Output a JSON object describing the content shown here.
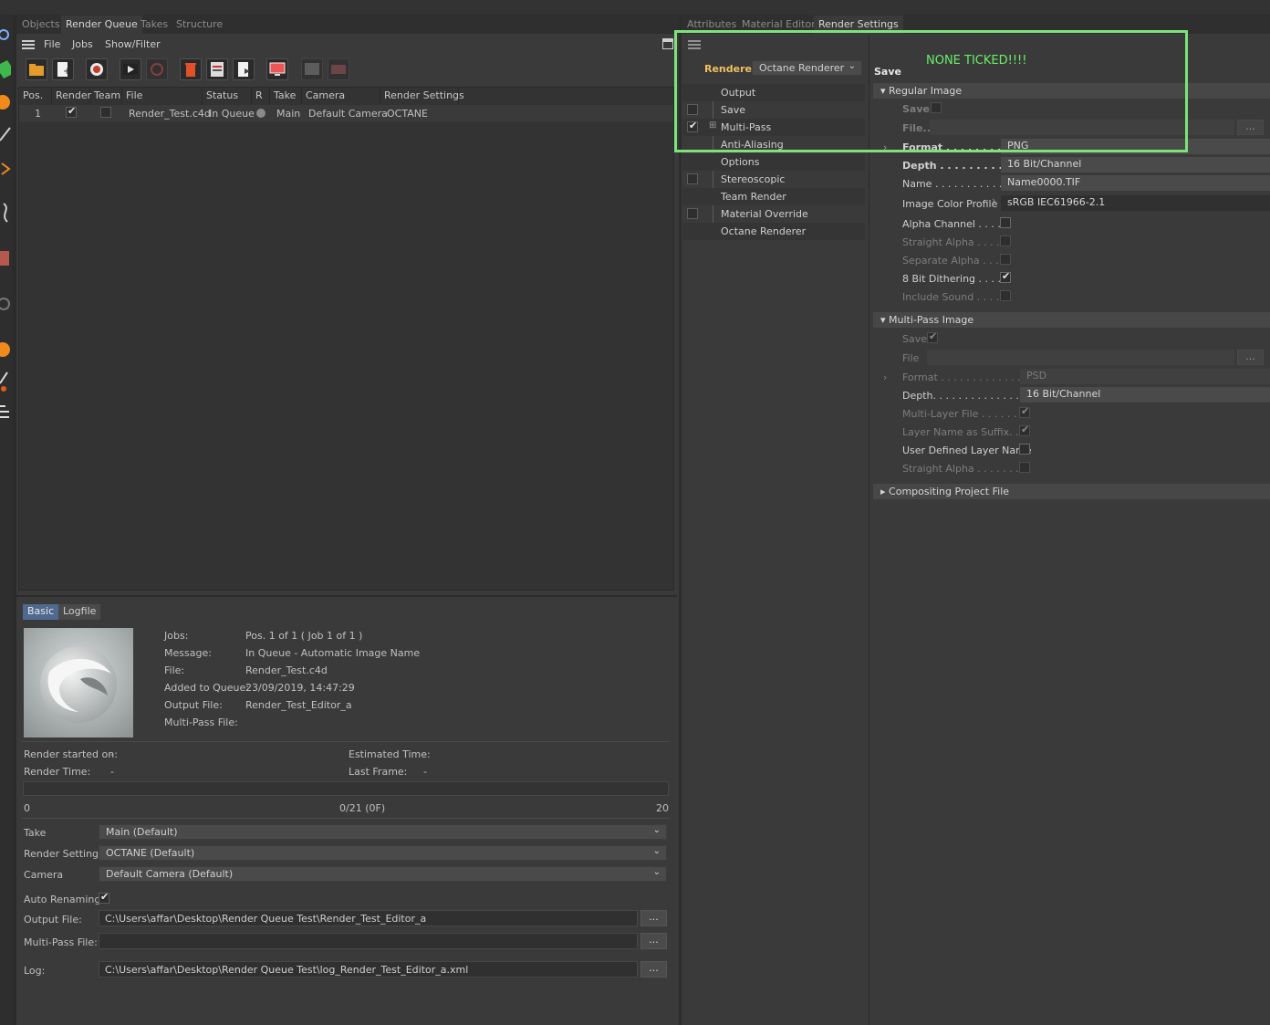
{
  "colors": {
    "accent_orange": "#f19c3c",
    "annotation_green": "#7ce27a",
    "panel_bg": "#3a3a3a"
  },
  "left_panel": {
    "tabs": [
      "Objects",
      "Render Queue",
      "Takes",
      "Structure"
    ],
    "menu": [
      "File",
      "Jobs",
      "Show/Filter"
    ],
    "toolbar_icons": [
      "open-folder-icon",
      "new-job-icon",
      "camera-icon",
      "render-icon",
      "stop-icon",
      "delete-icon",
      "info-icon",
      "export-icon",
      "monitor-icon",
      "picture-viewer-icon",
      "settings-icon"
    ],
    "table": {
      "headers": [
        "Pos.",
        "Render",
        "Team",
        "File",
        "Status",
        "R",
        "Take",
        "Camera",
        "Render Settings"
      ],
      "rows": [
        {
          "pos": "1",
          "render": true,
          "team": false,
          "file": "Render_Test.c4d",
          "status": "In Queue",
          "take": "Main",
          "camera": "Default Camera",
          "render_settings": "OCTANE"
        }
      ]
    },
    "bottom": {
      "tabs": [
        "Basic",
        "Logfile"
      ],
      "info_labels": [
        "Jobs:",
        "Message:",
        "File:",
        "Added to Queue:",
        "Output File:",
        "Multi-Pass File:"
      ],
      "info_values": [
        "Pos. 1 of 1 ( Job 1 of 1 )",
        "In Queue - Automatic Image Name",
        "Render_Test.c4d",
        "23/09/2019, 14:47:29",
        "Render_Test_Editor_a",
        ""
      ],
      "render_started_label": "Render started on:",
      "render_started_value": "-",
      "render_time_label": "Render Time:",
      "render_time_value": "-",
      "estimated_label": "Estimated Time:",
      "estimated_value": "-",
      "last_frame_label": "Last Frame:",
      "last_frame_value": "-",
      "progress_start": "0",
      "progress_text": "0/21 (0F)",
      "progress_end": "20",
      "progress_fraction": 0,
      "take_label": "Take",
      "take_value": "Main (Default)",
      "settings_label": "Render Settings",
      "settings_value": "OCTANE (Default)",
      "camera_label": "Camera",
      "camera_value": "Default Camera (Default)",
      "auto_renaming_label": "Auto Renaming",
      "auto_renaming": true,
      "output_label": "Output File:",
      "output_value": "C:\\Users\\affar\\Desktop\\Render Queue Test\\Render_Test_Editor_a",
      "multipass_label": "Multi-Pass File:",
      "multipass_value": "",
      "log_label": "Log:",
      "log_value": "C:\\Users\\affar\\Desktop\\Render Queue Test\\log_Render_Test_Editor_a.xml",
      "ellipsis": "..."
    }
  },
  "right_panel": {
    "tabs": [
      "Attributes",
      "Material Editor",
      "Render Settings"
    ],
    "renderer_label": "Renderer",
    "renderer_value": "Octane Renderer",
    "tree": [
      {
        "label": "Output",
        "checkbox": "none"
      },
      {
        "label": "Save",
        "checkbox": "off",
        "active": true
      },
      {
        "label": "Multi-Pass",
        "checkbox": "on",
        "expandable": true
      },
      {
        "label": "Anti-Aliasing",
        "checkbox": "none"
      },
      {
        "label": "Options",
        "checkbox": "none"
      },
      {
        "label": "Stereoscopic",
        "checkbox": "off"
      },
      {
        "label": "Team Render",
        "checkbox": "none"
      },
      {
        "label": "Material Override",
        "checkbox": "off"
      },
      {
        "label": "Octane Renderer",
        "checkbox": "none"
      }
    ],
    "save_title": "Save",
    "annotation": "NONE TICKED!!!!",
    "regular_image": {
      "title": "Regular Image",
      "save_label": "Save",
      "save_checked": false,
      "file_label": "File...",
      "format_label": "Format . . . . . . . . .",
      "format_value": "PNG",
      "depth_label": "Depth . . . . . . . . . .",
      "depth_value": "16 Bit/Channel",
      "name_label": "Name . . . . . . . . . . .",
      "name_value": "Name0000.TIF",
      "profile_label": "Image Color Profile",
      "profile_value": "sRGB IEC61966-2.1",
      "checks": [
        {
          "label": "Alpha Channel . . . .",
          "checked": false,
          "dim": false
        },
        {
          "label": "Straight Alpha . . . .",
          "checked": false,
          "dim": true
        },
        {
          "label": "Separate Alpha . . .",
          "checked": false,
          "dim": true
        },
        {
          "label": "8 Bit Dithering . . . .",
          "checked": true,
          "dim": false
        },
        {
          "label": "Include Sound . . . .",
          "checked": false,
          "dim": true
        }
      ]
    },
    "multipass_image": {
      "title": "Multi-Pass Image",
      "save_label": "Save",
      "file_label": "File",
      "format_label": "Format . . . . . . . . . . . . .",
      "format_value": "PSD",
      "depth_label": "Depth. . . . . . . . . . . . . . .",
      "depth_value": "16 Bit/Channel",
      "checks": [
        {
          "label": "Multi-Layer File . . . . . .",
          "checked": true,
          "dim": true
        },
        {
          "label": "Layer Name as Suffix. . .",
          "checked": true,
          "dim": true
        },
        {
          "label": "User Defined Layer Name",
          "checked": false,
          "dim": false
        },
        {
          "label": "Straight Alpha . . . . . . . .",
          "checked": false,
          "dim": true
        }
      ]
    },
    "compositing_title": "Compositing Project File"
  }
}
